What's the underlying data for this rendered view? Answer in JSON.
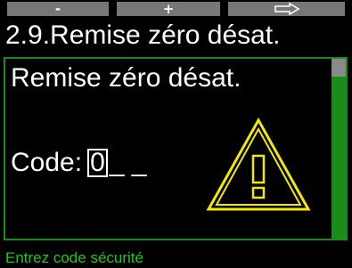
{
  "softkeys": {
    "left": "-",
    "middle": "+",
    "right_icon": "arrow-right-icon"
  },
  "title": "2.9.Remise zéro désat.",
  "panel": {
    "heading": "Remise zéro désat.",
    "code_label": "Code:",
    "code_digit": "0",
    "code_remaining": "_ _",
    "warning_icon": "warning-icon"
  },
  "status_text": "Entrez code sécurité",
  "colors": {
    "accent_green": "#1a8c1a",
    "status_green": "#1ec81e",
    "softkey_gray": "#777777",
    "warning_yellow": "#f2e800"
  }
}
